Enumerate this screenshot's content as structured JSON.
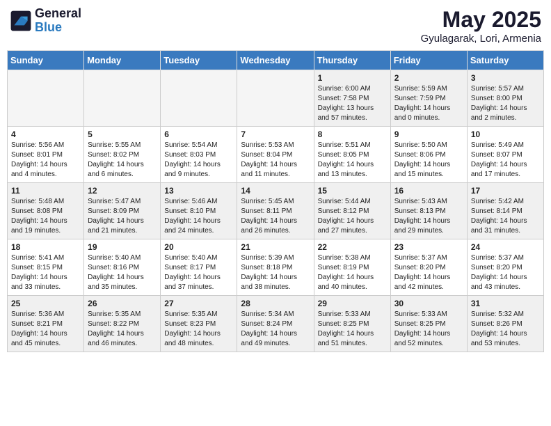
{
  "header": {
    "logo_general": "General",
    "logo_blue": "Blue",
    "month_year": "May 2025",
    "location": "Gyulagarak, Lori, Armenia"
  },
  "days_of_week": [
    "Sunday",
    "Monday",
    "Tuesday",
    "Wednesday",
    "Thursday",
    "Friday",
    "Saturday"
  ],
  "weeks": [
    [
      {
        "day": "",
        "content": ""
      },
      {
        "day": "",
        "content": ""
      },
      {
        "day": "",
        "content": ""
      },
      {
        "day": "",
        "content": ""
      },
      {
        "day": "1",
        "content": "Sunrise: 6:00 AM\nSunset: 7:58 PM\nDaylight: 13 hours\nand 57 minutes."
      },
      {
        "day": "2",
        "content": "Sunrise: 5:59 AM\nSunset: 7:59 PM\nDaylight: 14 hours\nand 0 minutes."
      },
      {
        "day": "3",
        "content": "Sunrise: 5:57 AM\nSunset: 8:00 PM\nDaylight: 14 hours\nand 2 minutes."
      }
    ],
    [
      {
        "day": "4",
        "content": "Sunrise: 5:56 AM\nSunset: 8:01 PM\nDaylight: 14 hours\nand 4 minutes."
      },
      {
        "day": "5",
        "content": "Sunrise: 5:55 AM\nSunset: 8:02 PM\nDaylight: 14 hours\nand 6 minutes."
      },
      {
        "day": "6",
        "content": "Sunrise: 5:54 AM\nSunset: 8:03 PM\nDaylight: 14 hours\nand 9 minutes."
      },
      {
        "day": "7",
        "content": "Sunrise: 5:53 AM\nSunset: 8:04 PM\nDaylight: 14 hours\nand 11 minutes."
      },
      {
        "day": "8",
        "content": "Sunrise: 5:51 AM\nSunset: 8:05 PM\nDaylight: 14 hours\nand 13 minutes."
      },
      {
        "day": "9",
        "content": "Sunrise: 5:50 AM\nSunset: 8:06 PM\nDaylight: 14 hours\nand 15 minutes."
      },
      {
        "day": "10",
        "content": "Sunrise: 5:49 AM\nSunset: 8:07 PM\nDaylight: 14 hours\nand 17 minutes."
      }
    ],
    [
      {
        "day": "11",
        "content": "Sunrise: 5:48 AM\nSunset: 8:08 PM\nDaylight: 14 hours\nand 19 minutes."
      },
      {
        "day": "12",
        "content": "Sunrise: 5:47 AM\nSunset: 8:09 PM\nDaylight: 14 hours\nand 21 minutes."
      },
      {
        "day": "13",
        "content": "Sunrise: 5:46 AM\nSunset: 8:10 PM\nDaylight: 14 hours\nand 24 minutes."
      },
      {
        "day": "14",
        "content": "Sunrise: 5:45 AM\nSunset: 8:11 PM\nDaylight: 14 hours\nand 26 minutes."
      },
      {
        "day": "15",
        "content": "Sunrise: 5:44 AM\nSunset: 8:12 PM\nDaylight: 14 hours\nand 27 minutes."
      },
      {
        "day": "16",
        "content": "Sunrise: 5:43 AM\nSunset: 8:13 PM\nDaylight: 14 hours\nand 29 minutes."
      },
      {
        "day": "17",
        "content": "Sunrise: 5:42 AM\nSunset: 8:14 PM\nDaylight: 14 hours\nand 31 minutes."
      }
    ],
    [
      {
        "day": "18",
        "content": "Sunrise: 5:41 AM\nSunset: 8:15 PM\nDaylight: 14 hours\nand 33 minutes."
      },
      {
        "day": "19",
        "content": "Sunrise: 5:40 AM\nSunset: 8:16 PM\nDaylight: 14 hours\nand 35 minutes."
      },
      {
        "day": "20",
        "content": "Sunrise: 5:40 AM\nSunset: 8:17 PM\nDaylight: 14 hours\nand 37 minutes."
      },
      {
        "day": "21",
        "content": "Sunrise: 5:39 AM\nSunset: 8:18 PM\nDaylight: 14 hours\nand 38 minutes."
      },
      {
        "day": "22",
        "content": "Sunrise: 5:38 AM\nSunset: 8:19 PM\nDaylight: 14 hours\nand 40 minutes."
      },
      {
        "day": "23",
        "content": "Sunrise: 5:37 AM\nSunset: 8:20 PM\nDaylight: 14 hours\nand 42 minutes."
      },
      {
        "day": "24",
        "content": "Sunrise: 5:37 AM\nSunset: 8:20 PM\nDaylight: 14 hours\nand 43 minutes."
      }
    ],
    [
      {
        "day": "25",
        "content": "Sunrise: 5:36 AM\nSunset: 8:21 PM\nDaylight: 14 hours\nand 45 minutes."
      },
      {
        "day": "26",
        "content": "Sunrise: 5:35 AM\nSunset: 8:22 PM\nDaylight: 14 hours\nand 46 minutes."
      },
      {
        "day": "27",
        "content": "Sunrise: 5:35 AM\nSunset: 8:23 PM\nDaylight: 14 hours\nand 48 minutes."
      },
      {
        "day": "28",
        "content": "Sunrise: 5:34 AM\nSunset: 8:24 PM\nDaylight: 14 hours\nand 49 minutes."
      },
      {
        "day": "29",
        "content": "Sunrise: 5:33 AM\nSunset: 8:25 PM\nDaylight: 14 hours\nand 51 minutes."
      },
      {
        "day": "30",
        "content": "Sunrise: 5:33 AM\nSunset: 8:25 PM\nDaylight: 14 hours\nand 52 minutes."
      },
      {
        "day": "31",
        "content": "Sunrise: 5:32 AM\nSunset: 8:26 PM\nDaylight: 14 hours\nand 53 minutes."
      }
    ]
  ]
}
